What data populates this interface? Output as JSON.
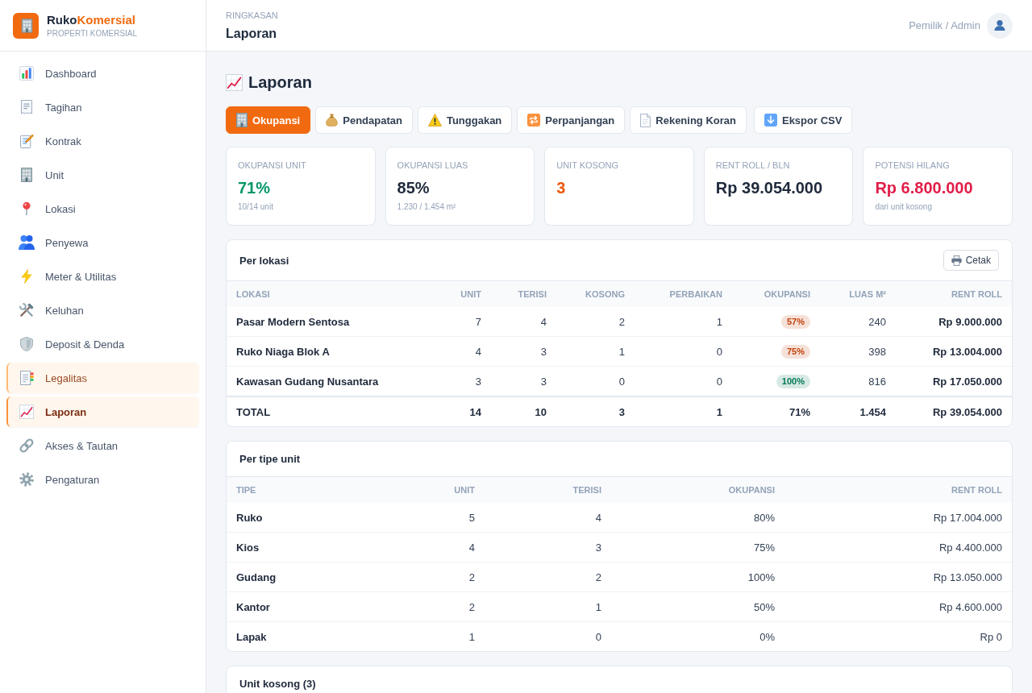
{
  "brand": {
    "name": "Ruko",
    "name_accent": "Komersial",
    "tagline": "PROPERTI KOMERSIAL"
  },
  "sidebar": {
    "items": [
      {
        "label": "Dashboard",
        "selected": false,
        "highlighted": false
      },
      {
        "label": "Tagihan",
        "selected": false,
        "highlighted": false
      },
      {
        "label": "Kontrak",
        "selected": false,
        "highlighted": false
      },
      {
        "label": "Unit",
        "selected": false,
        "highlighted": false
      },
      {
        "label": "Lokasi",
        "selected": false,
        "highlighted": false
      },
      {
        "label": "Penyewa",
        "selected": false,
        "highlighted": false
      },
      {
        "label": "Meter & Utilitas",
        "selected": false,
        "highlighted": false
      },
      {
        "label": "Keluhan",
        "selected": false,
        "highlighted": false
      },
      {
        "label": "Deposit & Denda",
        "selected": false,
        "highlighted": false
      },
      {
        "label": "Legalitas",
        "selected": false,
        "highlighted": true
      },
      {
        "label": "Laporan",
        "selected": true,
        "highlighted": true
      },
      {
        "label": "Akses & Tautan",
        "selected": false,
        "highlighted": false
      },
      {
        "label": "Pengaturan",
        "selected": false,
        "highlighted": false
      }
    ]
  },
  "header": {
    "eyebrow": "RINGKASAN",
    "title": "Laporan",
    "user": "Pemilik / Admin"
  },
  "page": {
    "title": "Laporan"
  },
  "tabs": [
    {
      "label": "Okupansi",
      "selected": true
    },
    {
      "label": "Pendapatan",
      "selected": false
    },
    {
      "label": "Tunggakan",
      "selected": false
    },
    {
      "label": "Perpanjangan",
      "selected": false
    },
    {
      "label": "Rekening Koran",
      "selected": false
    }
  ],
  "export_button": {
    "label": "Ekspor CSV"
  },
  "kpis": [
    {
      "label": "OKUPANSI UNIT",
      "value": "71%",
      "note": "10/14 unit",
      "color": "#059669"
    },
    {
      "label": "OKUPANSI LUAS",
      "value": "85%",
      "note": "1.230 / 1.454 m²",
      "color": "#1e293b"
    },
    {
      "label": "UNIT KOSONG",
      "value": "3",
      "color": "#ea580c"
    },
    {
      "label": "RENT ROLL / BLN",
      "value": "Rp 39.054.000",
      "color": "#1e293b"
    },
    {
      "label": "POTENSI HILANG",
      "value": "Rp 6.800.000",
      "note": "dari unit kosong",
      "color": "#e11d48"
    }
  ],
  "per_lokasi": {
    "title": "Per lokasi",
    "print_button": "Cetak",
    "columns": [
      "LOKASI",
      "UNIT",
      "TERISI",
      "KOSONG",
      "PERBAIKAN",
      "OKUPANSI",
      "LUAS M²",
      "RENT ROLL"
    ],
    "rows": [
      {
        "cells": [
          "Pasar Modern Sentosa",
          "7",
          "4",
          "2",
          "1",
          "57%",
          "240",
          "Rp 9.000.000"
        ],
        "color": "#c2410c"
      },
      {
        "cells": [
          "Ruko Niaga Blok A",
          "4",
          "3",
          "1",
          "0",
          "75%",
          "398",
          "Rp 13.004.000"
        ],
        "color": "#c2410c"
      },
      {
        "cells": [
          "Kawasan Gudang Nusantara",
          "3",
          "3",
          "0",
          "0",
          "100%",
          "816",
          "Rp 17.050.000"
        ],
        "color": "#047857"
      }
    ],
    "total": [
      "TOTAL",
      "14",
      "10",
      "3",
      "1",
      "71%",
      "1.454",
      "Rp 39.054.000"
    ]
  },
  "per_tipe": {
    "title": "Per tipe unit",
    "columns": [
      "TIPE",
      "UNIT",
      "TERISI",
      "OKUPANSI",
      "RENT ROLL"
    ],
    "rows": [
      [
        "Ruko",
        "5",
        "4",
        "80%",
        "Rp 17.004.000"
      ],
      [
        "Kios",
        "4",
        "3",
        "75%",
        "Rp 4.400.000"
      ],
      [
        "Gudang",
        "2",
        "2",
        "100%",
        "Rp 13.050.000"
      ],
      [
        "Kantor",
        "2",
        "1",
        "50%",
        "Rp 4.600.000"
      ],
      [
        "Lapak",
        "1",
        "0",
        "0%",
        "Rp 0"
      ]
    ]
  },
  "unit_kosong": {
    "title": "Unit kosong (3)"
  }
}
